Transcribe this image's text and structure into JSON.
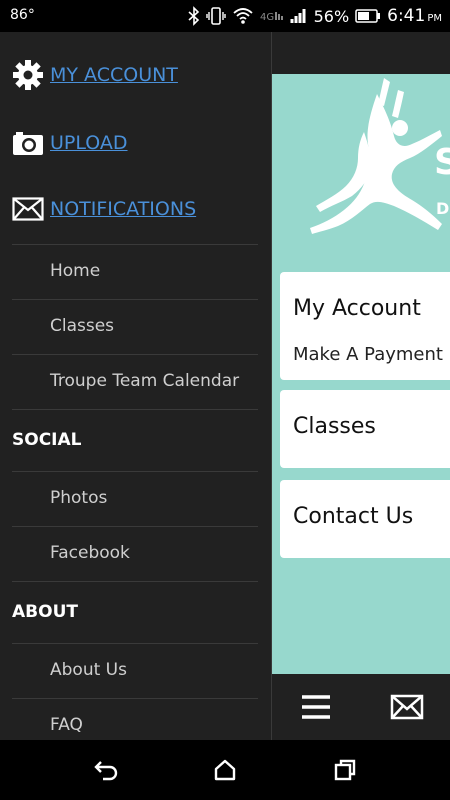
{
  "status_bar": {
    "temperature": "86°",
    "battery_percent": "56%",
    "time": "6:41",
    "ampm": "PM",
    "icons": [
      "bluetooth-icon",
      "vibrate-icon",
      "wifi-icon",
      "4g-icon",
      "signal-icon",
      "battery-icon"
    ]
  },
  "drawer": {
    "primary": [
      {
        "label": "MY ACCOUNT",
        "icon": "gear-icon"
      },
      {
        "label": "UPLOAD",
        "icon": "camera-icon"
      },
      {
        "label": "NOTIFICATIONS",
        "icon": "envelope-icon"
      }
    ],
    "items": [
      "Home",
      "Classes",
      "Troupe Team Calendar"
    ],
    "social": {
      "title": "SOCIAL",
      "items": [
        "Photos",
        "Facebook"
      ]
    },
    "about": {
      "title": "ABOUT",
      "items": [
        "About Us",
        "FAQ"
      ]
    }
  },
  "background_app": {
    "hero_partial_text": [
      "S",
      "D"
    ],
    "cards": [
      {
        "title": "My Account",
        "subtitle": "Make A Payment ,"
      },
      {
        "title": "Classes"
      },
      {
        "title": "Contact Us"
      }
    ],
    "bottom_icons": [
      "menu-icon",
      "envelope-icon"
    ],
    "accent_color": "#97d8cd"
  },
  "colors": {
    "drawer_bg": "#212121",
    "link": "#4a90d9",
    "teal": "#97d8cd"
  },
  "nav_bar": {
    "icons": [
      "back-icon",
      "home-icon",
      "recents-icon"
    ]
  }
}
